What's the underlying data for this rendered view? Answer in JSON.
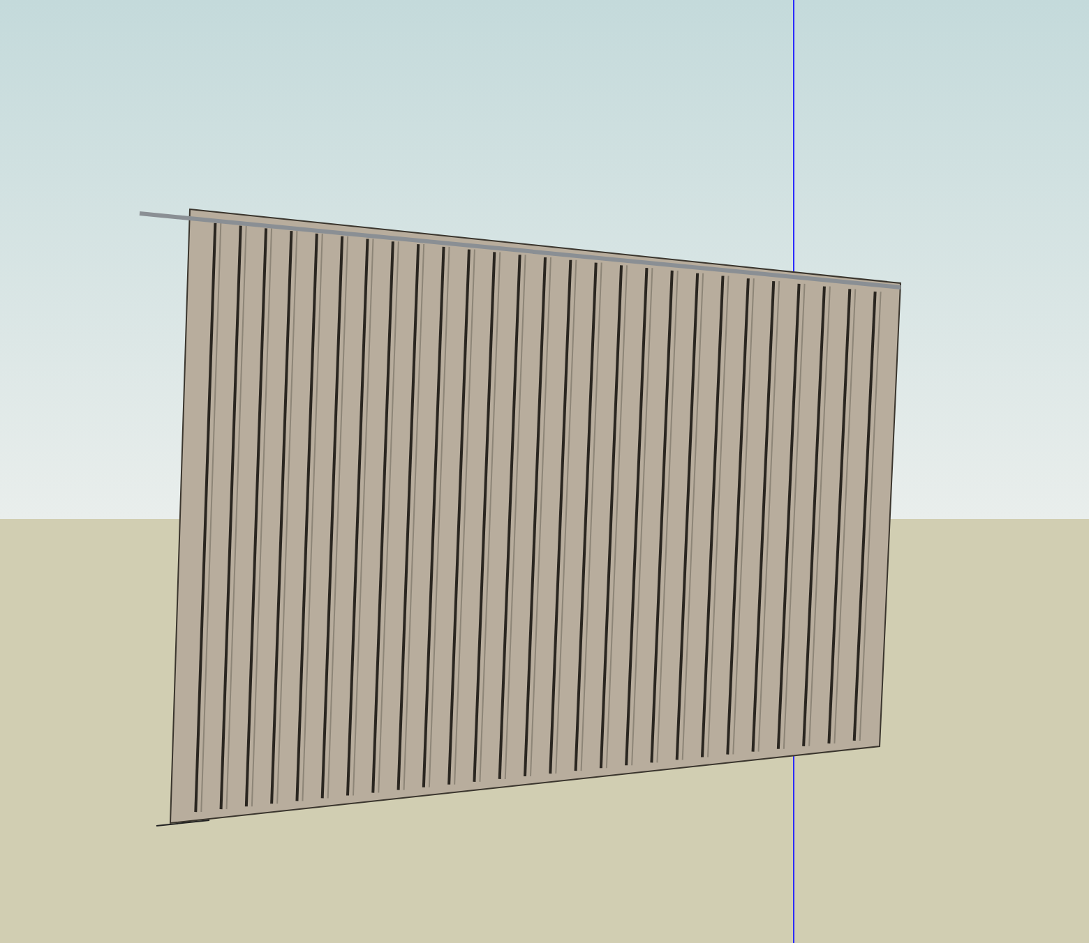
{
  "viewport": {
    "kind": "scene"
  }
}
